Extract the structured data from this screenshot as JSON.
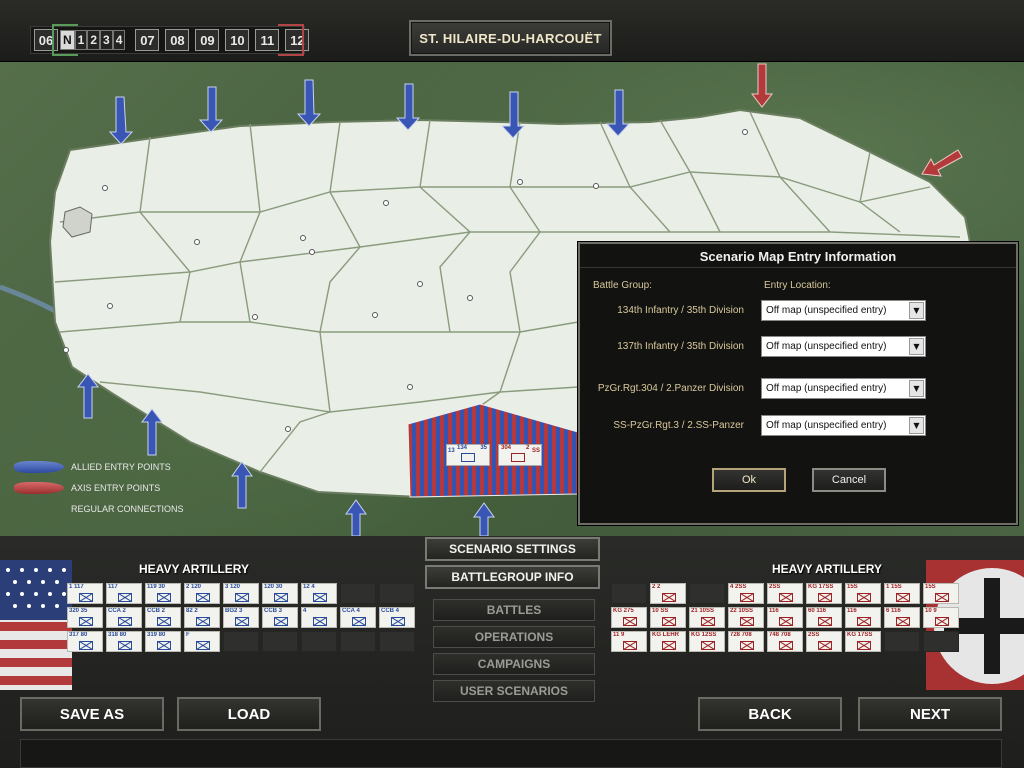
{
  "topbar": {
    "day_first": "06",
    "turn_current": "N",
    "turns": [
      "1",
      "2",
      "3",
      "4"
    ],
    "days": [
      "07",
      "08",
      "09",
      "10",
      "11",
      "12"
    ],
    "location": "ST. HILAIRE-DU-HARCOUËT"
  },
  "map": {
    "legend": {
      "allied": "ALLIED ENTRY POINTS",
      "axis": "AXIS ENTRY POINTS",
      "regular": "REGULAR CONNECTIONS"
    },
    "counters": {
      "allied": "134",
      "allied_size": "35",
      "allied_left": "13",
      "axis": "304",
      "axis_size": "2",
      "axis_right": "SS"
    },
    "colors": {
      "allied": "#3553b3",
      "axis": "#b23a3a",
      "map_land": "#e9eee6"
    }
  },
  "dialog": {
    "title": "Scenario Map Entry Information",
    "col_group": "Battle Group:",
    "col_entry": "Entry Location:",
    "rows": [
      {
        "group": "134th Infantry / 35th Division",
        "entry": "Off map (unspecified entry)"
      },
      {
        "group": "137th Infantry / 35th Division",
        "entry": "Off map (unspecified entry)"
      },
      {
        "group": "PzGr.Rgt.304 / 2.Panzer Division",
        "entry": "Off map (unspecified entry)"
      },
      {
        "group": "SS-PzGr.Rgt.3 / 2.SS-Panzer",
        "entry": "Off map (unspecified entry)"
      }
    ],
    "ok": "Ok",
    "cancel": "Cancel"
  },
  "bottom": {
    "allied_title": "HEAVY ARTILLERY",
    "axis_title": "HEAVY ARTILLERY",
    "scenario_settings": "SCENARIO SETTINGS",
    "battlegroup_info": "BATTLEGROUP INFO",
    "menu": [
      "BATTLES",
      "OPERATIONS",
      "CAMPAIGNS",
      "USER SCENARIOS"
    ],
    "save_as": "SAVE AS",
    "load": "LOAD",
    "back": "BACK",
    "next": "NEXT",
    "allied_units": [
      "1 117",
      "117",
      "119 30",
      "2 120",
      "3 120",
      "120 30",
      "12 4",
      "",
      "",
      "320 35",
      "CCA 2",
      "CCB 2",
      "82 2",
      "BG2 3",
      "CCB 3",
      "4",
      "CCA 4",
      "CCB 4",
      "317 80",
      "318 80",
      "319 80",
      "F",
      "",
      "",
      "",
      "",
      ""
    ],
    "axis_units": [
      "",
      "2 2",
      "",
      "4 2SS",
      "2SS",
      "KG 17SS",
      "15S",
      "1 15S",
      "15S",
      "KG 275",
      "10 SS",
      "21 10SS",
      "22 10SS",
      "116",
      "60 116",
      "116",
      "6 116",
      "10 9",
      "11 9",
      "KG LEHR",
      "KG 12SS",
      "728 708",
      "748 708",
      "2SS",
      "KG 17SS",
      "",
      ""
    ]
  }
}
